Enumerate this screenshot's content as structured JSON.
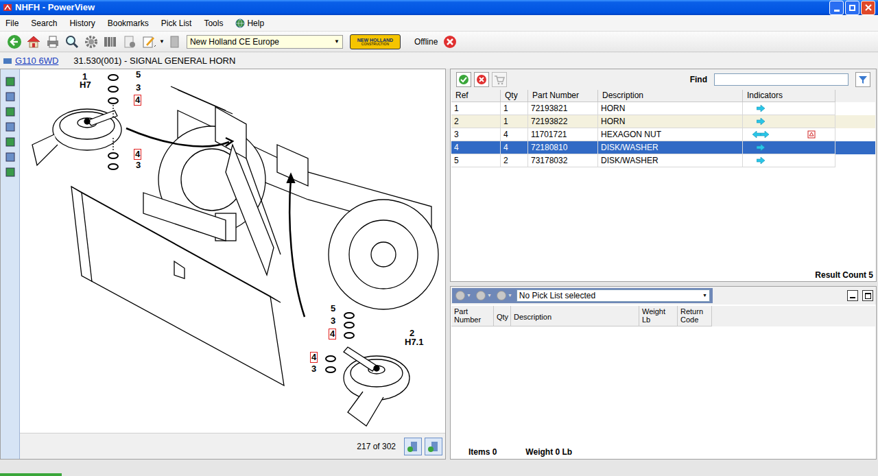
{
  "window": {
    "title": "NHFH - PowerView"
  },
  "menu": [
    {
      "label": "File",
      "kind": "text"
    },
    {
      "label": "Search",
      "kind": "text"
    },
    {
      "label": "History",
      "kind": "text"
    },
    {
      "label": "Bookmarks",
      "kind": "text"
    },
    {
      "label": "Pick List",
      "kind": "text"
    },
    {
      "label": "Tools",
      "kind": "text"
    },
    {
      "label": "Help",
      "kind": "globe"
    }
  ],
  "toolbar": {
    "catalog": "New Holland CE Europe",
    "logo_top": "NEW HOLLAND",
    "logo_bottom": "CONSTRUCTION",
    "status": "Offline"
  },
  "breadcrumb": {
    "link": "G110 6WD",
    "title": "31.530(001) - SIGNAL GENERAL HORN"
  },
  "diagram": {
    "callouts": [
      {
        "text": "1",
        "boxed": false
      },
      {
        "text": "H7",
        "boxed": false
      },
      {
        "text": "5",
        "boxed": false
      },
      {
        "text": "3",
        "boxed": false
      },
      {
        "text": "4",
        "boxed": true
      },
      {
        "text": "4",
        "boxed": true
      },
      {
        "text": "3",
        "boxed": false
      },
      {
        "text": "5",
        "boxed": false
      },
      {
        "text": "3",
        "boxed": false
      },
      {
        "text": "4",
        "boxed": true
      },
      {
        "text": "4",
        "boxed": true
      },
      {
        "text": "3",
        "boxed": false
      },
      {
        "text": "2",
        "boxed": false
      },
      {
        "text": "H7.1",
        "boxed": false
      }
    ],
    "page": "217 of 302"
  },
  "parts": {
    "find_label": "Find",
    "find_value": "",
    "columns": [
      "Ref",
      "Qty",
      "Part Number",
      "Description",
      "Indicators"
    ],
    "rows": [
      {
        "ref": "1",
        "qty": "1",
        "part": "72193821",
        "desc": "HORN",
        "arrows": "right",
        "pdf": false,
        "selected": false
      },
      {
        "ref": "2",
        "qty": "1",
        "part": "72193822",
        "desc": "HORN",
        "arrows": "right",
        "pdf": false,
        "selected": false
      },
      {
        "ref": "3",
        "qty": "4",
        "part": "11701721",
        "desc": "HEXAGON NUT",
        "arrows": "both",
        "pdf": true,
        "selected": false
      },
      {
        "ref": "4",
        "qty": "4",
        "part": "72180810",
        "desc": "DISK/WASHER",
        "arrows": "right",
        "pdf": false,
        "selected": true
      },
      {
        "ref": "5",
        "qty": "2",
        "part": "73178032",
        "desc": "DISK/WASHER",
        "arrows": "right",
        "pdf": false,
        "selected": false
      }
    ],
    "result": "Result Count 5"
  },
  "picklist": {
    "selector": "No Pick List selected",
    "columns": [
      [
        "Part",
        "Number"
      ],
      [
        "Qty"
      ],
      [
        "Description"
      ],
      [
        "Weight",
        "Lb"
      ],
      [
        "Return",
        "Code"
      ]
    ],
    "items": "Items 0",
    "weight": "Weight 0 Lb"
  }
}
